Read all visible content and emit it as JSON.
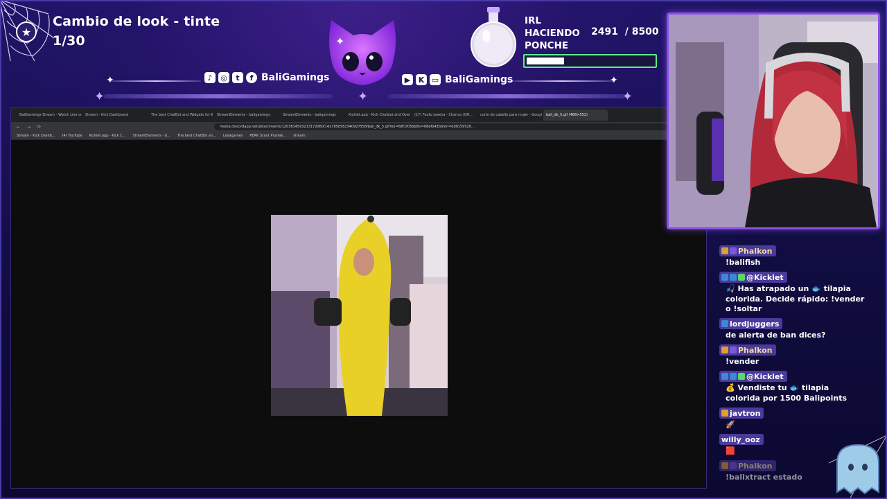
{
  "goal": {
    "title": "Cambio de look - tinte",
    "count": "1/30"
  },
  "social_left": {
    "handle": "BaliGamings",
    "icons": [
      "tiktok-icon",
      "instagram-icon",
      "twitter-icon",
      "facebook-icon"
    ]
  },
  "social_right": {
    "handle": "BaliGamings",
    "icons": [
      "youtube-icon",
      "kick-icon",
      "twitch-icon"
    ]
  },
  "irl_goal": {
    "line1": "IRL",
    "line2": "HACIENDO",
    "line3": "PONCHE",
    "progress_text": "2491  / 8500",
    "progress_fraction": 0.293
  },
  "browser": {
    "tabs": [
      "BaliGamings Stream - Watch Live on...",
      "Stream - Kick Dashboard",
      "The best ChatBot and Widgets for K...",
      "StreamElements - baligamings",
      "StreamElements - baligamings",
      "Kicklet.app - Kick Chatbot and Overl...",
      "(17) Feuto Leedra - Chance (Off...",
      "corte de cabello para mujer - Googl...",
      "bali_dk_5.gif (488×552)"
    ],
    "url": "media.discordapp.net/attachments/1203814593213172060/1427850582340927558/bali_dk_5.gif?ex=68f1f05bb8is=68efb43bbhm=dd9159520...",
    "bookmarks": [
      "Stream - Kick Dashb...",
      "(4) YouTube",
      "Kicklet.app - Kick C...",
      "StreamElements - b...",
      "The best ChatBot an...",
      "Lexagames",
      "PEAK Scout Plushie...",
      "stream"
    ]
  },
  "chat": [
    {
      "user": "Phalkon",
      "text": "!balifish",
      "color": "#f4d9a0"
    },
    {
      "user": "@Kicklet",
      "text": "🎣 Has atrapado un 🐟 tilapia colorida. Decide rápido: !vender o !soltar",
      "color": "#ffffff"
    },
    {
      "user": "lordjuggers",
      "text": "de alerta de ban dices?",
      "color": "#ffffff"
    },
    {
      "user": "Phalkon",
      "text": "!vender",
      "color": "#f4d9a0"
    },
    {
      "user": "@Kicklet",
      "text": "💰 Vendiste tu 🐟 tilapia colorida por 1500 Balipoints",
      "color": "#ffffff"
    },
    {
      "user": "javtron",
      "text": "🚀",
      "color": "#ffffff"
    },
    {
      "user": "willy_ooz",
      "text": "🟥",
      "color": "#ffffff"
    },
    {
      "user": "Phalkon",
      "text": "!balixtract estado",
      "color": "#f4d9a0"
    }
  ],
  "colors": {
    "accent": "#8a4ee8",
    "bar_border": "#5cf08a",
    "chip": "#4a3a9a"
  }
}
